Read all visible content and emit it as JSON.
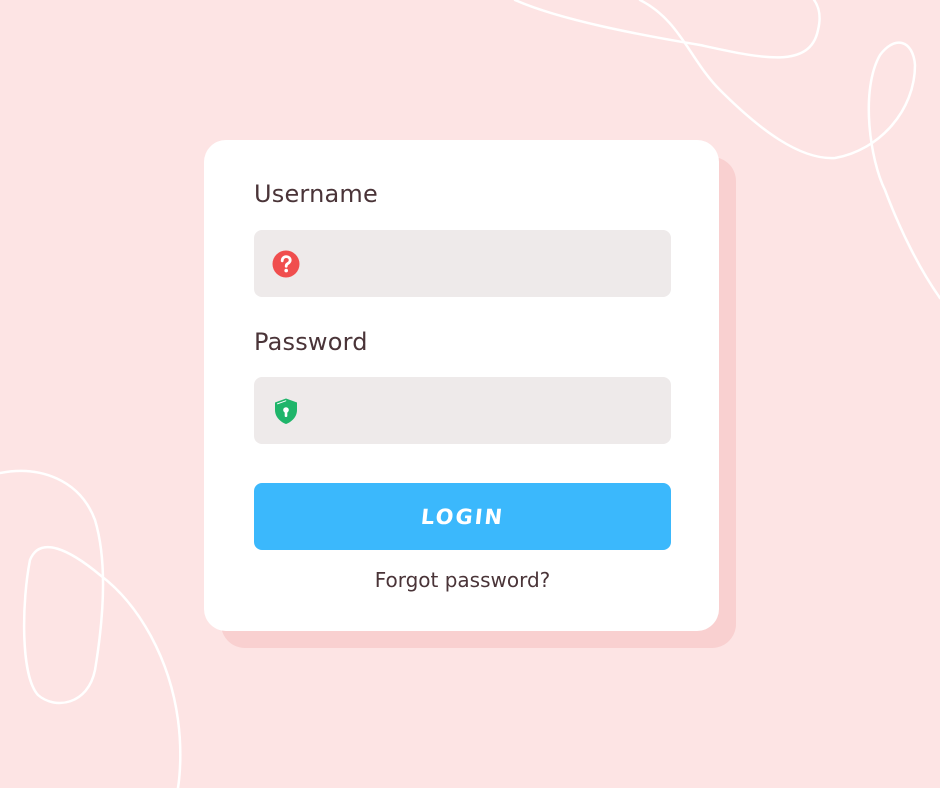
{
  "form": {
    "username_label": "Username",
    "username_value": "",
    "username_icon": "question-circle-icon",
    "password_label": "Password",
    "password_value": "",
    "password_icon": "shield-lock-icon",
    "login_label": "LOGIN",
    "forgot_label": "Forgot password?"
  },
  "colors": {
    "background": "#fde4e4",
    "card": "#ffffff",
    "card_shadow": "#f9d0d0",
    "field": "#eeeaea",
    "button": "#3bb8fc",
    "text": "#4a3438",
    "username_icon": "#f04e4e",
    "password_icon": "#1fb56a"
  }
}
